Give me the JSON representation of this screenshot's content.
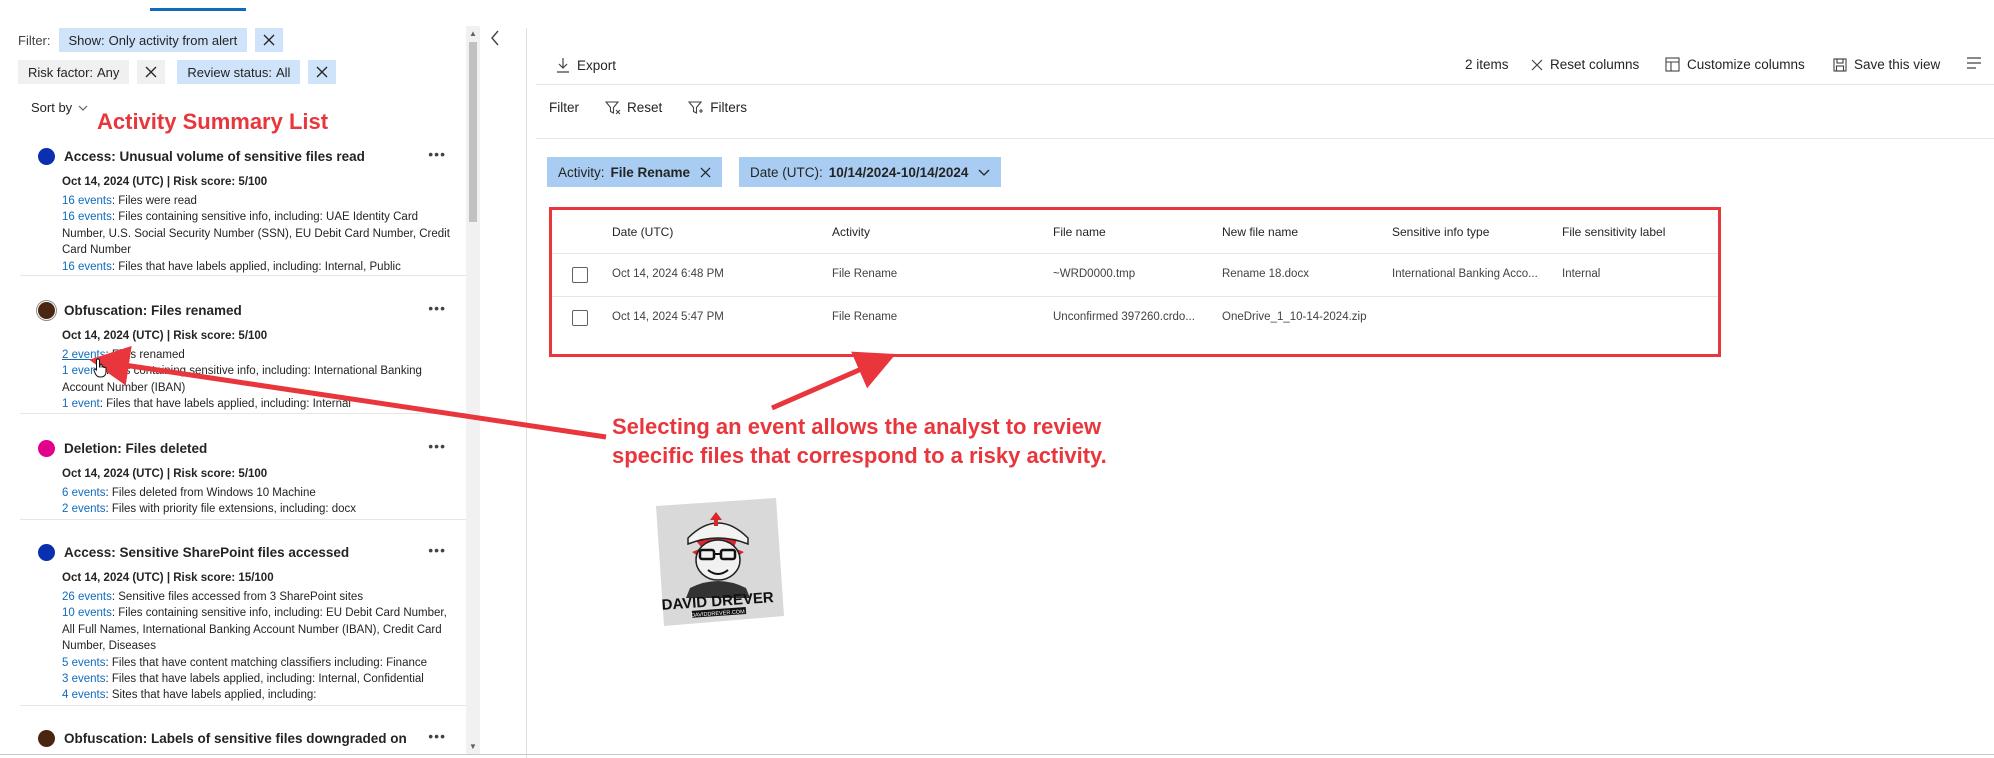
{
  "filters": {
    "label": "Filter:",
    "chips_row1": [
      {
        "key": "Show:",
        "value": "Only activity from alert"
      }
    ],
    "chips_row2": [
      {
        "key": "Risk factor:",
        "value": "Any"
      },
      {
        "key": "Review status:",
        "value": "All"
      }
    ]
  },
  "sort": {
    "label": "Sort by"
  },
  "annotations": {
    "list_title": "Activity Summary List",
    "callout_line1": "Selecting an event allows the analyst to review",
    "callout_line2": "specific files that correspond to a risky activity."
  },
  "activities": [
    {
      "title": "Access: Unusual volume of sensitive files read",
      "color": "#0a2fb0",
      "meta": "Oct 14, 2024 (UTC) | Risk score: 5/100",
      "lines": [
        {
          "link": "16 events",
          "text": ": Files were read"
        },
        {
          "link": "16 events",
          "text": ": Files containing sensitive info, including: UAE Identity Card Number, U.S. Social Security Number (SSN), EU Debit Card Number, Credit Card Number"
        },
        {
          "link": "16 events",
          "text": ": Files that have labels applied, including: Internal, Public"
        }
      ]
    },
    {
      "title": "Obfuscation: Files renamed",
      "color": "#4a2511",
      "meta": "Oct 14, 2024 (UTC) | Risk score: 5/100",
      "lines": [
        {
          "link": "2 events",
          "text": ": Files renamed"
        },
        {
          "link": "1 event",
          "text": ": Files containing sensitive info, including: International Banking Account Number (IBAN)"
        },
        {
          "link": "1 event",
          "text": ": Files that have labels applied, including: Internal"
        }
      ]
    },
    {
      "title": "Deletion: Files deleted",
      "color": "#e3008c",
      "meta": "Oct 14, 2024 (UTC) | Risk score: 5/100",
      "lines": [
        {
          "link": "6 events",
          "text": ": Files deleted from Windows 10 Machine"
        },
        {
          "link": "2 events",
          "text": ": Files with priority file extensions, including: docx"
        }
      ]
    },
    {
      "title": "Access: Sensitive SharePoint files accessed",
      "color": "#0a2fb0",
      "meta": "Oct 14, 2024 (UTC) | Risk score: 15/100",
      "lines": [
        {
          "link": "26 events",
          "text": ": Sensitive files accessed from 3 SharePoint sites"
        },
        {
          "link": "10 events",
          "text": ": Files containing sensitive info, including: EU Debit Card Number, All Full Names, International Banking Account Number (IBAN), Credit Card Number, Diseases"
        },
        {
          "link": "5 events",
          "text": ": Files that have content matching classifiers including: Finance"
        },
        {
          "link": "3 events",
          "text": ": Files that have labels applied, including: Internal, Confidential"
        },
        {
          "link": "4 events",
          "text": ": Sites that have labels applied, including:"
        }
      ]
    },
    {
      "title": "Obfuscation: Labels of sensitive files downgraded on",
      "color": "#4a2511",
      "meta": "",
      "lines": []
    }
  ],
  "toolbar": {
    "export": "Export",
    "items_count": "2 items",
    "reset_columns": "Reset columns",
    "customize_columns": "Customize columns",
    "save_view": "Save this view"
  },
  "filterbar": {
    "label": "Filter",
    "reset": "Reset",
    "filters": "Filters"
  },
  "pills": {
    "activity": {
      "key": "Activity:",
      "value": "File Rename"
    },
    "date": {
      "key": "Date (UTC):",
      "value": "10/14/2024-10/14/2024"
    }
  },
  "table": {
    "columns": [
      "Date (UTC)",
      "Activity",
      "File name",
      "New file name",
      "Sensitive info type",
      "File sensitivity label"
    ],
    "rows": [
      [
        "Oct 14, 2024 6:48 PM",
        "File Rename",
        "~WRD0000.tmp",
        "Rename 18.docx",
        "International Banking Acco...",
        "Internal"
      ],
      [
        "Oct 14, 2024 5:47 PM",
        "File Rename",
        "Unconfirmed 397260.crdo...",
        "OneDrive_1_10-14-2024.zip",
        "",
        ""
      ]
    ]
  },
  "logo": {
    "line1": "DAVID DREVER",
    "line2": "DAVIDDREVER.COM"
  }
}
